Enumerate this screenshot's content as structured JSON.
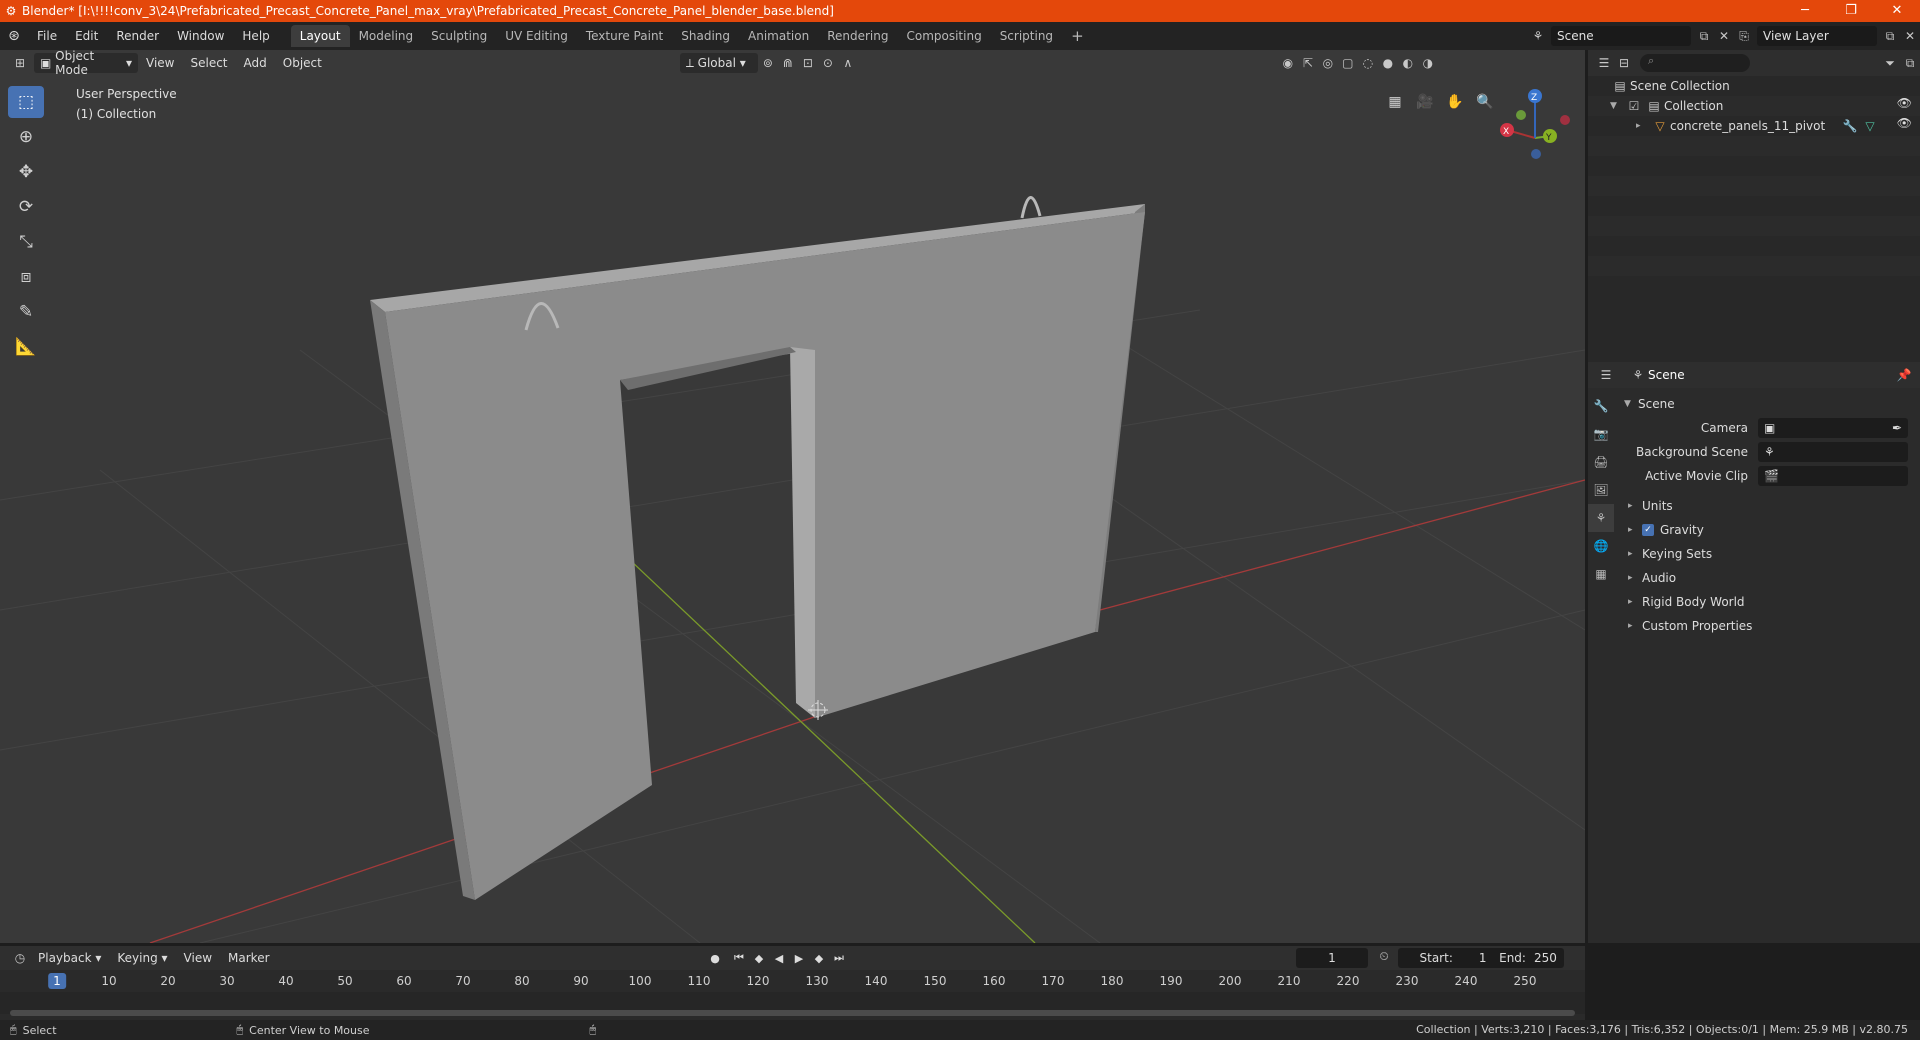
{
  "window": {
    "title": "Blender* [I:\\!!!!conv_3\\24\\Prefabricated_Precast_Concrete_Panel_max_vray\\Prefabricated_Precast_Concrete_Panel_blender_base.blend]",
    "minimize": "─",
    "maximize": "❐",
    "close": "✕"
  },
  "menubar": {
    "items": [
      "File",
      "Edit",
      "Render",
      "Window",
      "Help"
    ],
    "tabs": [
      "Layout",
      "Modeling",
      "Sculpting",
      "UV Editing",
      "Texture Paint",
      "Shading",
      "Animation",
      "Rendering",
      "Compositing",
      "Scripting"
    ],
    "active_tab": "Layout",
    "add_tab": "+",
    "scene": "Scene",
    "view_layer": "View Layer"
  },
  "viewport": {
    "mode": "Object Mode",
    "menus": [
      "View",
      "Select",
      "Add",
      "Object"
    ],
    "orientation": "Global",
    "info_line1": "User Perspective",
    "info_line2": "(1) Collection",
    "gizmo": {
      "x": "X",
      "y": "Y",
      "z": "Z"
    }
  },
  "outliner": {
    "rows": [
      {
        "label": "Scene Collection",
        "icon": "collection-icon"
      },
      {
        "label": "Collection",
        "icon": "collection-icon"
      },
      {
        "label": "concrete_panels_11_pivot",
        "icon": "mesh-icon"
      }
    ]
  },
  "properties": {
    "header": "Scene",
    "section": "Scene",
    "fields": [
      {
        "label": "Camera",
        "value": ""
      },
      {
        "label": "Background Scene",
        "value": ""
      },
      {
        "label": "Active Movie Clip",
        "value": ""
      }
    ],
    "subpanels": [
      "Units",
      "Gravity",
      "Keying Sets",
      "Audio",
      "Rigid Body World",
      "Custom Properties"
    ]
  },
  "timeline": {
    "menus": [
      "Playback",
      "Keying",
      "View",
      "Marker"
    ],
    "current_frame": "1",
    "start_label": "Start:",
    "start": "1",
    "end_label": "End:",
    "end": "250",
    "ruler": [
      "1",
      "10",
      "20",
      "30",
      "40",
      "50",
      "60",
      "70",
      "80",
      "90",
      "100",
      "110",
      "120",
      "130",
      "140",
      "150",
      "160",
      "170",
      "180",
      "190",
      "200",
      "210",
      "220",
      "230",
      "240",
      "250"
    ]
  },
  "statusbar": {
    "select": "Select",
    "center": "Center View to Mouse",
    "stats": "Collection | Verts:3,210 | Faces:3,176 | Tris:6,352 | Objects:0/1 | Mem: 25.9 MB | v2.80.75"
  },
  "colors": {
    "titlebar": "#e4480b",
    "accent": "#4772b3",
    "viewport_bg": "#393939",
    "panel_face": "#888888",
    "x_axis": "#a33a3a",
    "y_axis": "#7a9a2a"
  }
}
